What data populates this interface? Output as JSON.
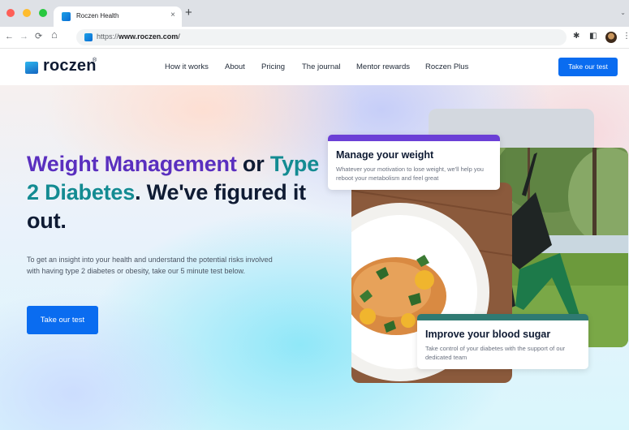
{
  "browser": {
    "tab_title": "Roczen Health",
    "tab_close": "×",
    "new_tab": "+",
    "tabs_menu": "⌄",
    "back": "←",
    "forward": "→",
    "reload": "⟳",
    "home": "⌂",
    "url_prefix": "https://",
    "url_host": "www.roczen.com",
    "url_suffix": "/",
    "extensions_icon": "✱",
    "sidepanel_icon": "◧",
    "menu_icon": "⋮"
  },
  "site": {
    "logo_text": "roczen",
    "logo_mark": "®",
    "nav_links": [
      "How it works",
      "About",
      "Pricing",
      "The journal",
      "Mentor rewards",
      "Roczen Plus"
    ],
    "nav_cta": "Take our test"
  },
  "hero": {
    "title_part1": "Weight Management",
    "title_part2": " or ",
    "title_part3": "Type 2 Diabetes",
    "title_part4": ". We've figured it out.",
    "description": "To get an insight into your health and understand the potential risks involved with having type 2 diabetes or obesity, take our 5 minute test below.",
    "cta": "Take our test"
  },
  "cards": {
    "weight": {
      "title": "Manage your weight",
      "text": "Whatever your motivation to lose weight, we'll help you reboot your metabolism and feel great"
    },
    "sugar": {
      "title": "Improve your blood sugar",
      "text": "Take control of your diabetes with the support of our dedicated team"
    }
  },
  "colors": {
    "primary": "#0a6cf0",
    "purple": "#5a2fbf",
    "teal": "#138b92",
    "weight_card_accent": "#6b3fd6",
    "sugar_card_accent": "#2f7a72"
  }
}
